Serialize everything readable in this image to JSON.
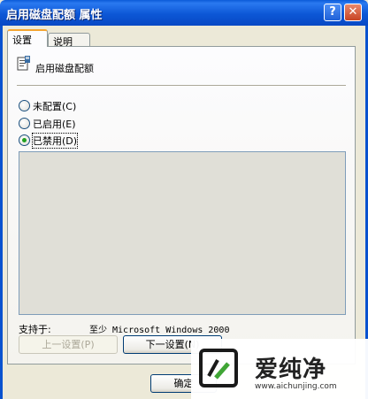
{
  "window": {
    "title": "启用磁盘配额 属性",
    "help_label": "?",
    "close_label": "✕"
  },
  "tabs": [
    {
      "label": "设置",
      "active": true
    },
    {
      "label": "说明",
      "active": false
    }
  ],
  "policy": {
    "name": "启用磁盘配额",
    "icon": "policy-setting-icon"
  },
  "options": [
    {
      "label": "未配置(C)",
      "selected": false
    },
    {
      "label": "已启用(E)",
      "selected": false
    },
    {
      "label": "已禁用(D)",
      "selected": true
    }
  ],
  "support": {
    "label": "支持于:",
    "value": "至少 Microsoft Windows 2000"
  },
  "buttons": {
    "prev": "上一设置(P)",
    "next": "下一设置(N)",
    "ok": "确定"
  },
  "watermark": {
    "brand": "爱纯净",
    "url": "www.aichunjing.com"
  },
  "colors": {
    "titlebar": "#0a5ad8",
    "face": "#ece9d8",
    "selected_radio": "#21a121"
  }
}
